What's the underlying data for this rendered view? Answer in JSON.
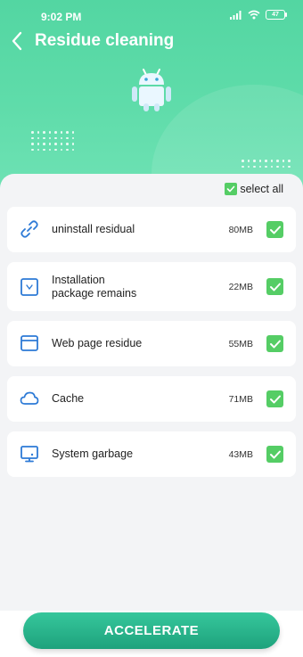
{
  "status_bar": {
    "time": "9:02 PM",
    "battery": "47"
  },
  "header": {
    "title": "Residue cleaning"
  },
  "select_all": {
    "label": "select all",
    "checked": true
  },
  "items": [
    {
      "icon": "link-icon",
      "name": "uninstall residual",
      "size": "80MB",
      "checked": true
    },
    {
      "icon": "package-icon",
      "name": "Installation\npackage remains",
      "size": "22MB",
      "checked": true
    },
    {
      "icon": "browser-window-icon",
      "name": "Web page residue",
      "size": "55MB",
      "checked": true
    },
    {
      "icon": "cloud-icon",
      "name": "Cache",
      "size": "71MB",
      "checked": true
    },
    {
      "icon": "monitor-icon",
      "name": "System garbage",
      "size": "43MB",
      "checked": true
    }
  ],
  "action": {
    "label": "ACCELERATE"
  },
  "colors": {
    "accent": "#55cd65",
    "header_green": "#5fdcaa",
    "icon_blue": "#2d7ad6",
    "button_green": "#1ea27c"
  }
}
